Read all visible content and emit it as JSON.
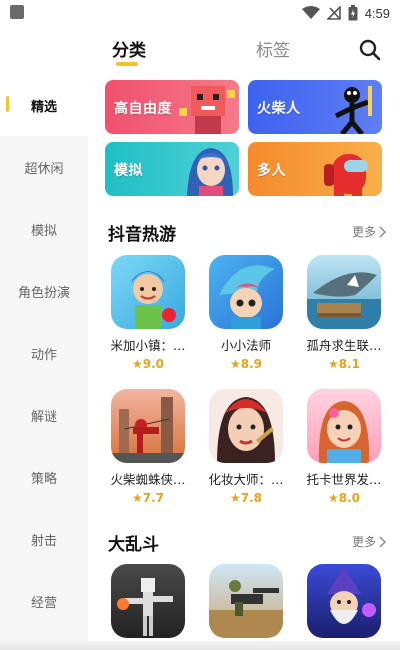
{
  "status_bar": {
    "time": "4:59"
  },
  "tabs": [
    {
      "label": "分类",
      "active": true
    },
    {
      "label": "标签",
      "active": false
    }
  ],
  "sidebar": {
    "items": [
      {
        "label": "精选",
        "active": true
      },
      {
        "label": "超休闲"
      },
      {
        "label": "模拟"
      },
      {
        "label": "角色扮演"
      },
      {
        "label": "动作"
      },
      {
        "label": "解谜"
      },
      {
        "label": "策略"
      },
      {
        "label": "射击"
      },
      {
        "label": "经营"
      }
    ]
  },
  "banners": [
    {
      "label": "高自由度",
      "color": "#f0506e"
    },
    {
      "label": "火柴人",
      "color": "#4f6cf0"
    },
    {
      "label": "模拟",
      "color": "#27c3c8"
    },
    {
      "label": "多人",
      "color": "#f59a35"
    }
  ],
  "sections": [
    {
      "title": "抖音热游",
      "more": "更多",
      "games": [
        {
          "name": "米加小镇：…",
          "rating": "9.0"
        },
        {
          "name": "小小法师",
          "rating": "8.9"
        },
        {
          "name": "孤舟求生联…",
          "rating": "8.1"
        },
        {
          "name": "火柴蜘蛛侠…",
          "rating": "7.7"
        },
        {
          "name": "化妆大师：…",
          "rating": "7.8"
        },
        {
          "name": "托卡世界发…",
          "rating": "8.0"
        }
      ]
    },
    {
      "title": "大乱斗",
      "more": "更多",
      "games": []
    }
  ],
  "colors": {
    "accent": "#f6c22b",
    "rating": "#e8a317"
  }
}
